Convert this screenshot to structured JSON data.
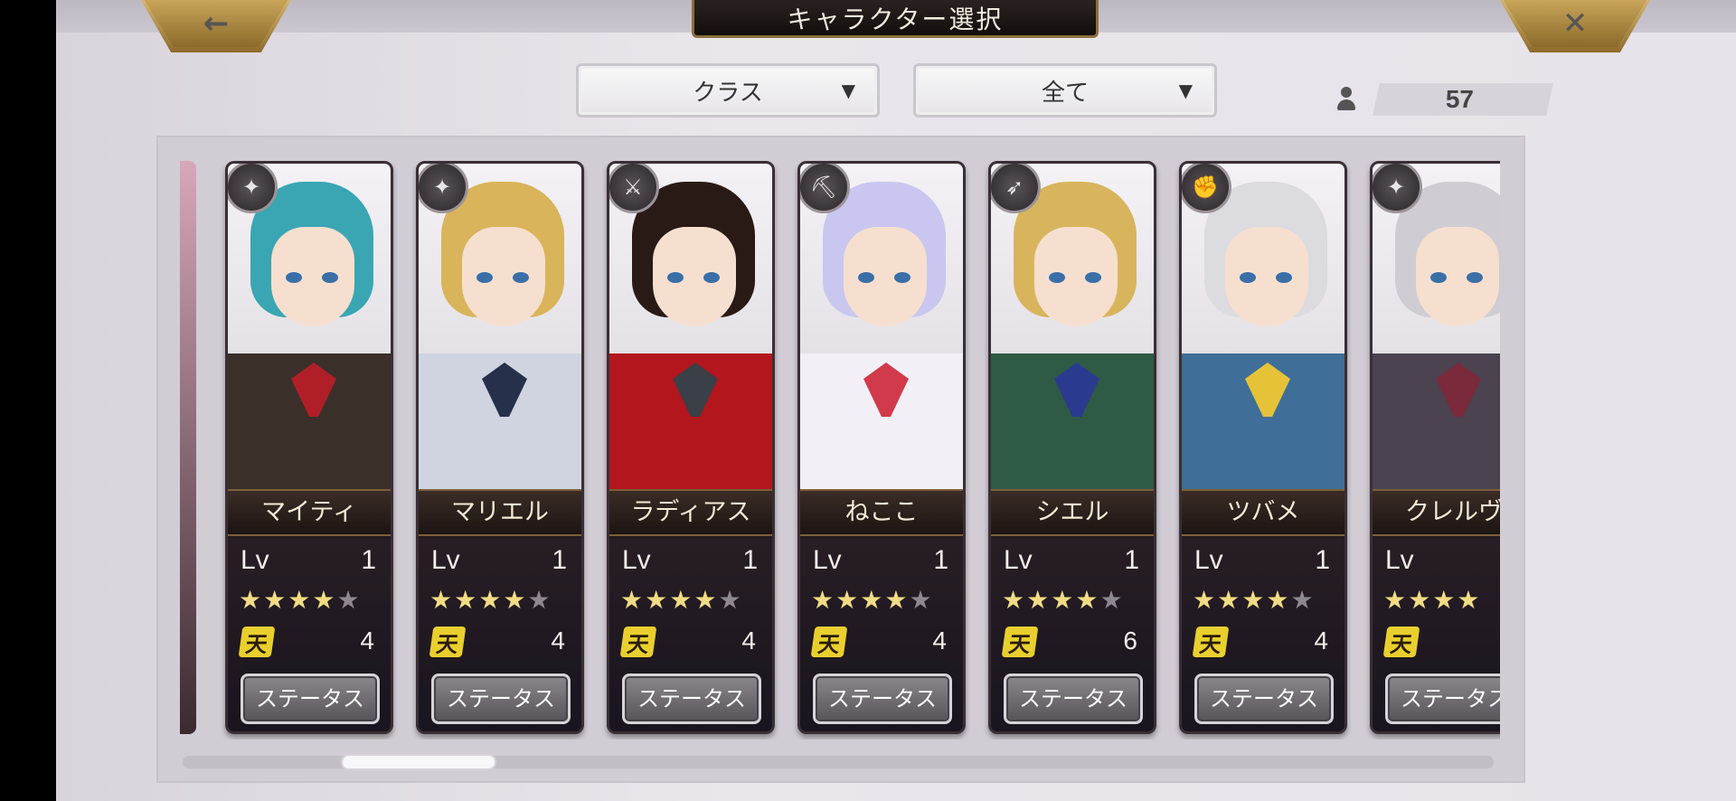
{
  "header": {
    "title": "キャラクター選択",
    "back_icon": "arrow-left",
    "close_icon": "x"
  },
  "filters": {
    "class_label": "クラス",
    "range_label": "全て",
    "caret": "▼"
  },
  "count": {
    "icon": "person-icon",
    "value": "57"
  },
  "cards": [
    {
      "name": "マイティ",
      "lv_label": "Lv",
      "lv": "1",
      "stars_on": 4,
      "stars_total": 5,
      "ten_label": "天",
      "ten": "4",
      "status_label": "ステータス",
      "class_icon": "staff",
      "hair": "#3aa6b3",
      "outfit": "#3b2f2a",
      "accent": "#b01f28"
    },
    {
      "name": "マリエル",
      "lv_label": "Lv",
      "lv": "1",
      "stars_on": 4,
      "stars_total": 5,
      "ten_label": "天",
      "ten": "4",
      "status_label": "ステータス",
      "class_icon": "staff",
      "hair": "#d9b45a",
      "outfit": "#cfd4e0",
      "accent": "#26304a"
    },
    {
      "name": "ラディアス",
      "lv_label": "Lv",
      "lv": "1",
      "stars_on": 4,
      "stars_total": 5,
      "ten_label": "天",
      "ten": "4",
      "status_label": "ステータス",
      "class_icon": "sword",
      "hair": "#2a1a15",
      "outfit": "#b3161c",
      "accent": "#3b3f47"
    },
    {
      "name": "ねここ",
      "lv_label": "Lv",
      "lv": "1",
      "stars_on": 4,
      "stars_total": 5,
      "ten_label": "天",
      "ten": "4",
      "status_label": "ステータス",
      "class_icon": "axe",
      "hair": "#c9c7ef",
      "outfit": "#f2f0f6",
      "accent": "#d13a4a"
    },
    {
      "name": "シエル",
      "lv_label": "Lv",
      "lv": "1",
      "stars_on": 4,
      "stars_total": 5,
      "ten_label": "天",
      "ten": "6",
      "status_label": "ステータス",
      "class_icon": "bow",
      "hair": "#d8b55c",
      "outfit": "#2f5a46",
      "accent": "#2a3b8f"
    },
    {
      "name": "ツバメ",
      "lv_label": "Lv",
      "lv": "1",
      "stars_on": 4,
      "stars_total": 5,
      "ten_label": "天",
      "ten": "4",
      "status_label": "ステータス",
      "class_icon": "fist",
      "hair": "#dcdbe0",
      "outfit": "#3f6f98",
      "accent": "#e6c238"
    },
    {
      "name": "クレルヴ",
      "lv_label": "Lv",
      "lv": "",
      "stars_on": 4,
      "stars_total": 4,
      "ten_label": "天",
      "ten": "",
      "status_label": "ステータス",
      "class_icon": "staff",
      "hair": "#cfcdd3",
      "outfit": "#4b4350",
      "accent": "#7a2a3a"
    }
  ]
}
